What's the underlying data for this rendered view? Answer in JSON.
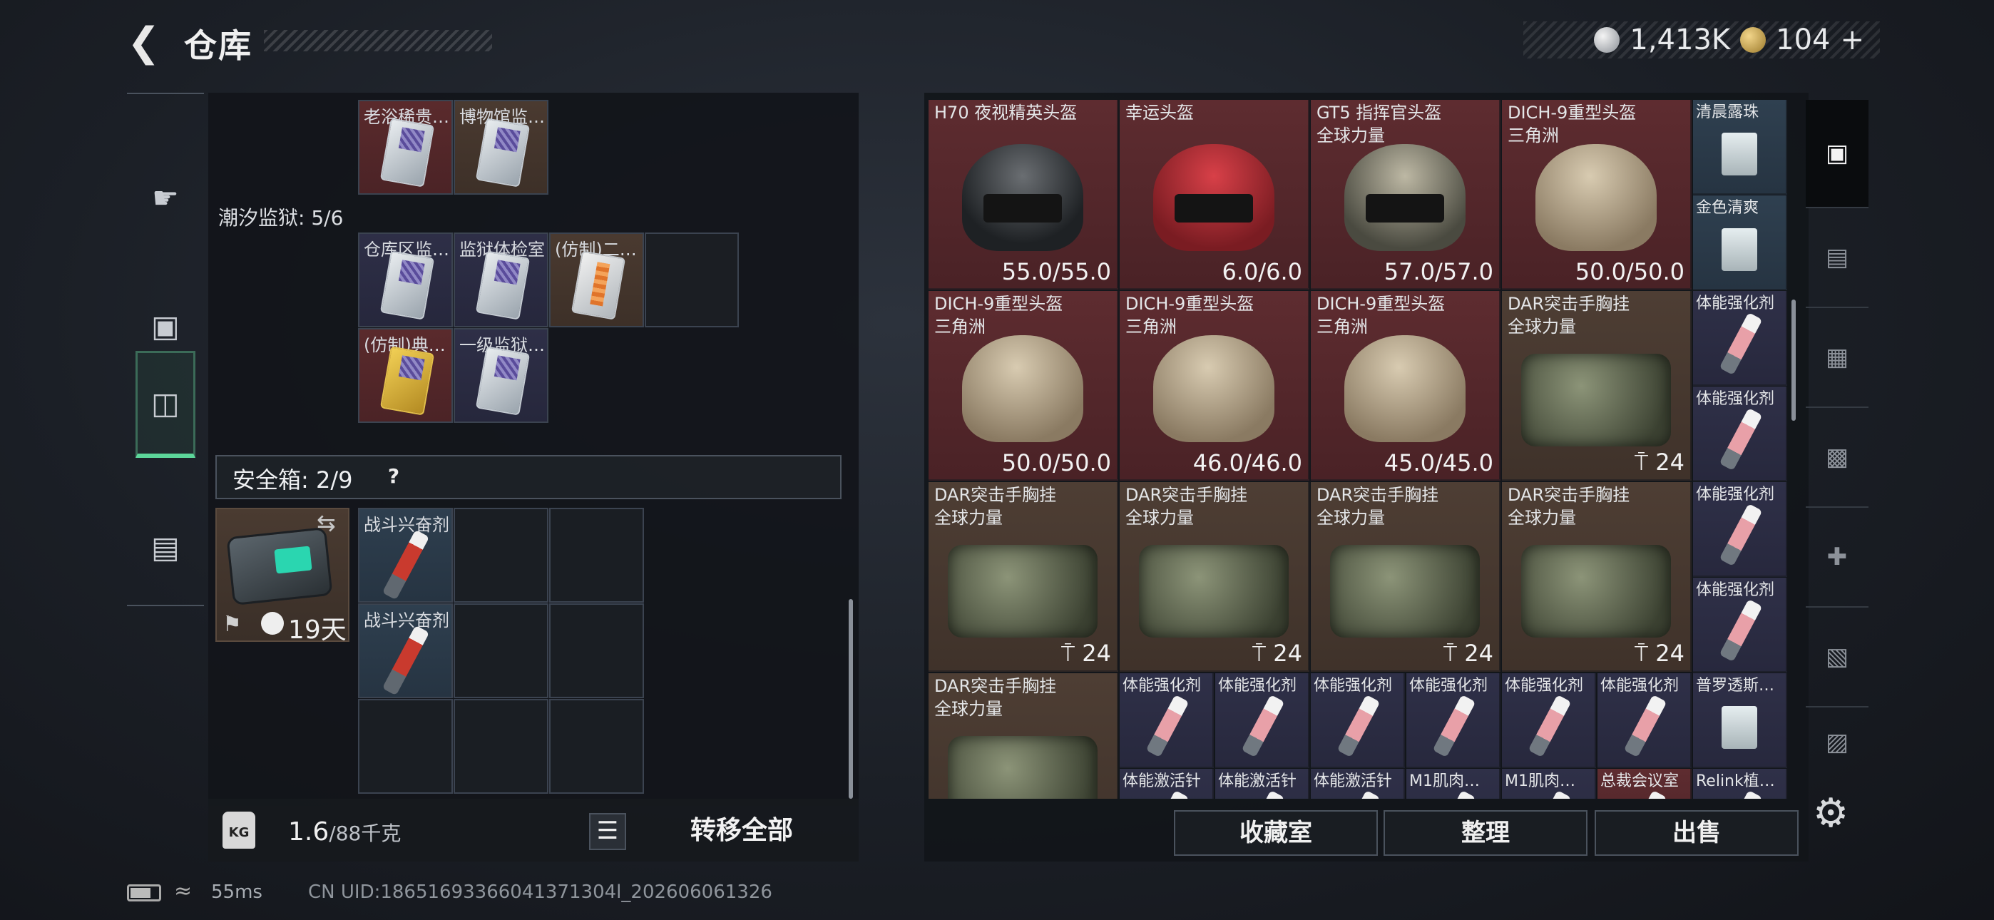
{
  "header": {
    "title": "仓库",
    "silver_amount": "1,413K",
    "gold_amount": "104",
    "gold_plus": "+"
  },
  "left_nav": [
    {
      "icon": "pistol-icon"
    },
    {
      "icon": "backpack-icon"
    },
    {
      "icon": "vest-icon",
      "active": true
    },
    {
      "icon": "toolbox-icon"
    }
  ],
  "cards_top": [
    {
      "label": "老浴稀贵…",
      "color": "grey",
      "bg": "red"
    },
    {
      "label": "博物馆监…",
      "color": "grey",
      "bg": "brown"
    }
  ],
  "prison_section": {
    "label": "潮汐监狱: 5/6"
  },
  "prison_cards": [
    {
      "label": "仓库区监…",
      "color": "grey",
      "bg": "purple"
    },
    {
      "label": "监狱体检室",
      "color": "grey",
      "bg": "purple"
    },
    {
      "label": "(仿制)二…",
      "color": "orange",
      "bg": "brown"
    },
    {
      "label": "(仿制)典…",
      "color": "yellow",
      "bg": "red"
    },
    {
      "label": "一级监狱…",
      "color": "grey",
      "bg": "purple"
    }
  ],
  "safe_box": {
    "label": "安全箱: 2/9",
    "help": "?",
    "days": "19天",
    "items": [
      {
        "label": "战斗兴奋剂"
      },
      {
        "label": "战斗兴奋剂"
      }
    ]
  },
  "weight": {
    "current": "1.6",
    "max": "/88千克"
  },
  "buttons": {
    "transfer_all": "转移全部",
    "collection_room": "收藏室",
    "organize": "整理",
    "sell": "出售"
  },
  "inventory": {
    "row1": [
      {
        "name": "H70 夜视精英头盔",
        "sub": "",
        "durability": "55.0/55.0",
        "kind": "black",
        "bg": "red"
      },
      {
        "name": "幸运头盔",
        "sub": "",
        "durability": "6.0/6.0",
        "kind": "redh",
        "bg": "red"
      },
      {
        "name": "GT5 指挥官头盔",
        "sub": "全球力量",
        "durability": "57.0/57.0",
        "kind": "green",
        "bg": "red"
      },
      {
        "name": "DICH-9重型头盔",
        "sub": "三角洲",
        "durability": "50.0/50.0",
        "kind": "tan",
        "bg": "red"
      }
    ],
    "row2": [
      {
        "name": "DICH-9重型头盔",
        "sub": "三角洲",
        "durability": "50.0/50.0",
        "kind": "tan",
        "bg": "red"
      },
      {
        "name": "DICH-9重型头盔",
        "sub": "三角洲",
        "durability": "46.0/46.0",
        "kind": "tan",
        "bg": "red"
      },
      {
        "name": "DICH-9重型头盔",
        "sub": "三角洲",
        "durability": "45.0/45.0",
        "kind": "tan",
        "bg": "red"
      },
      {
        "name": "DAR突击手胸挂",
        "sub": "全球力量",
        "capacity": "24",
        "kind": "bag",
        "bg": "brown"
      }
    ],
    "row3": [
      {
        "name": "DAR突击手胸挂",
        "sub": "全球力量",
        "capacity": "24",
        "kind": "bag",
        "bg": "brown"
      },
      {
        "name": "DAR突击手胸挂",
        "sub": "全球力量",
        "capacity": "24",
        "kind": "bag",
        "bg": "brown"
      },
      {
        "name": "DAR突击手胸挂",
        "sub": "全球力量",
        "capacity": "24",
        "kind": "bag",
        "bg": "brown"
      },
      {
        "name": "DAR突击手胸挂",
        "sub": "全球力量",
        "capacity": "24",
        "kind": "bag",
        "bg": "brown"
      }
    ],
    "row4_first": {
      "name": "DAR突击手胸挂",
      "sub": "全球力量",
      "kind": "bag",
      "bg": "brown"
    },
    "right_col": [
      {
        "name": "清晨露珠",
        "kind": "drink",
        "bg": "blue"
      },
      {
        "name": "金色清爽",
        "kind": "drink",
        "bg": "blue"
      },
      {
        "name": "体能强化剂",
        "kind": "syringe",
        "bg": "purple"
      },
      {
        "name": "体能强化剂",
        "kind": "syringe",
        "bg": "purple"
      },
      {
        "name": "体能强化剂",
        "kind": "syringe",
        "bg": "purple"
      },
      {
        "name": "体能强化剂",
        "kind": "syringe",
        "bg": "purple"
      }
    ],
    "row4_small": [
      {
        "name": "体能强化剂"
      },
      {
        "name": "体能强化剂"
      },
      {
        "name": "体能强化剂"
      },
      {
        "name": "体能强化剂"
      },
      {
        "name": "体能强化剂"
      },
      {
        "name": "体能强化剂"
      },
      {
        "name": "普罗透斯…"
      }
    ],
    "row5_small": [
      {
        "name": "体能激活针"
      },
      {
        "name": "体能激活针"
      },
      {
        "name": "体能激活针"
      },
      {
        "name": "M1肌肉…"
      },
      {
        "name": "M1肌肉…"
      },
      {
        "name": "总裁会议室"
      },
      {
        "name": "Relink植…"
      }
    ]
  },
  "right_nav": [
    {
      "icon": "all-items-icon",
      "active": true
    },
    {
      "icon": "IV-ammo-icon"
    },
    {
      "icon": "IV-image-icon"
    },
    {
      "icon": "V-helmet-icon"
    },
    {
      "icon": "IV-medkit-icon"
    },
    {
      "icon": "V-armor-icon"
    },
    {
      "icon": "V-bag-icon"
    }
  ],
  "status": {
    "ping": "55ms",
    "uid": "CN UID:18651693366041371304l_202606061326"
  }
}
